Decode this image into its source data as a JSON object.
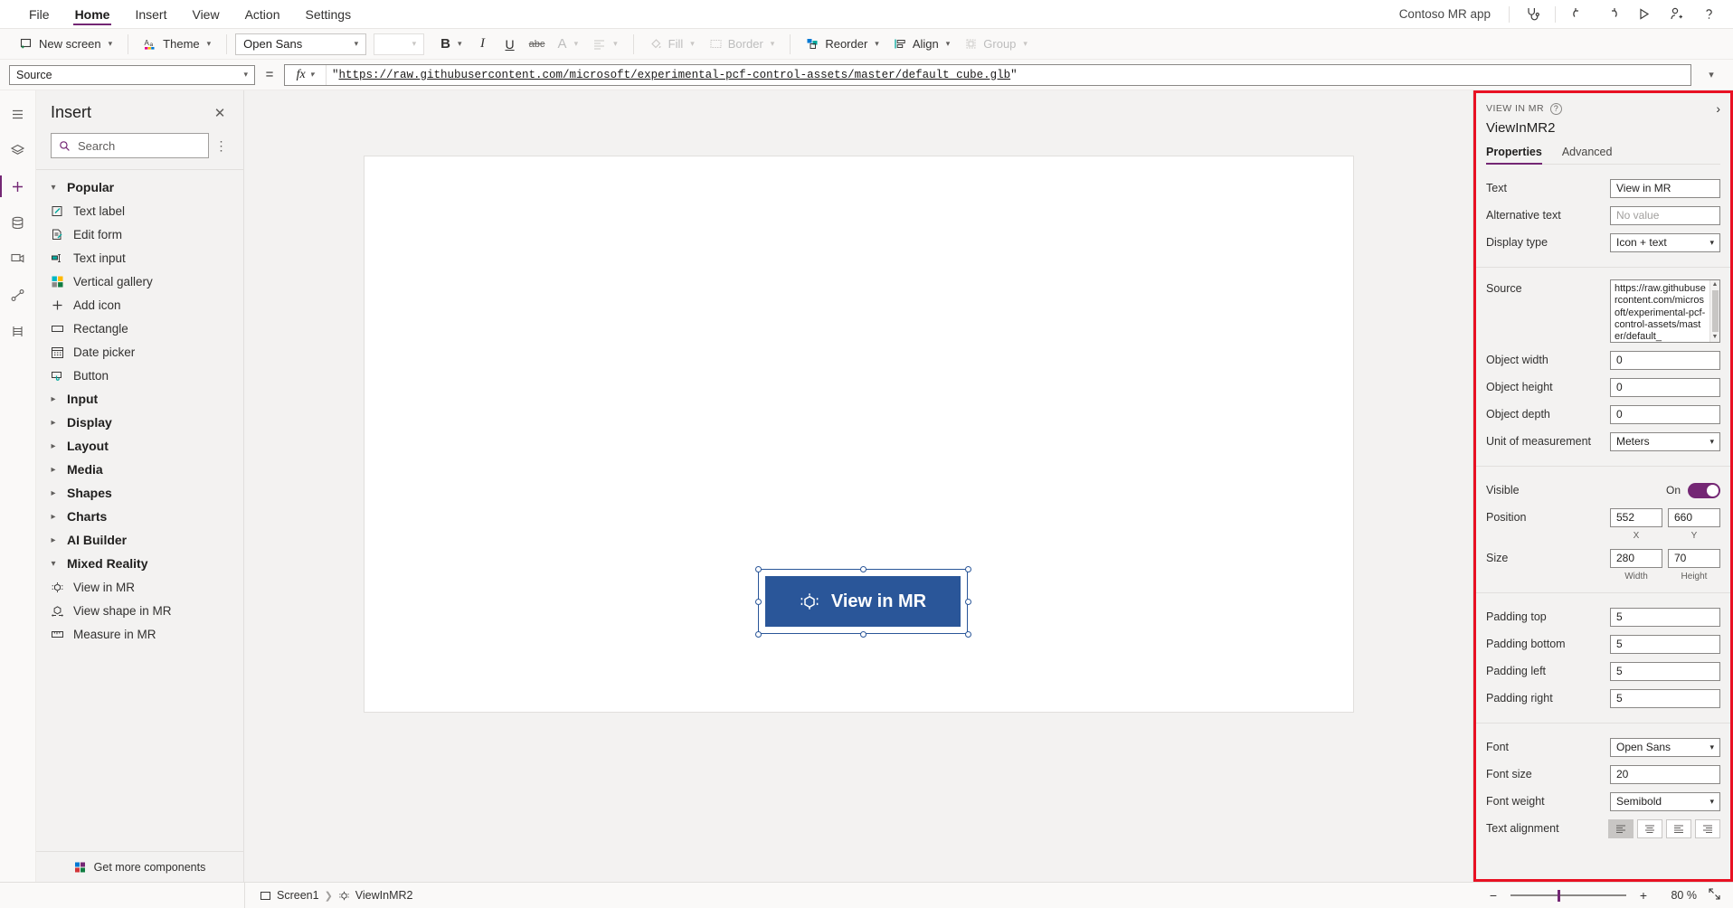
{
  "menubar": {
    "items": [
      "File",
      "Home",
      "Insert",
      "View",
      "Action",
      "Settings"
    ],
    "active": "Home",
    "app_name": "Contoso MR app",
    "icons": [
      "stethoscope-icon",
      "undo-icon",
      "redo-icon",
      "play-icon",
      "share-user-icon",
      "help-icon"
    ]
  },
  "ribbon": {
    "new_screen": "New screen",
    "theme": "Theme",
    "font_family": "Open Sans",
    "font_size": "",
    "bold": "B",
    "italic": "I",
    "underline": "U",
    "strikethrough": "abc",
    "font_color": "A",
    "align": "align-icon",
    "fill": "Fill",
    "border": "Border",
    "reorder": "Reorder",
    "align_label": "Align",
    "group": "Group"
  },
  "formula_bar": {
    "property": "Source",
    "equals": "=",
    "fx": "fx",
    "value_quote_open": "\"",
    "value_url": "https://raw.githubusercontent.com/microsoft/experimental-pcf-control-assets/master/default_cube.glb",
    "value_quote_close": "\""
  },
  "rail": {
    "items": [
      "hamburger-menu-icon",
      "layers-icon",
      "insert-plus-icon",
      "data-icon",
      "media-icon",
      "flow-icon",
      "variables-icon"
    ]
  },
  "insert_panel": {
    "title": "Insert",
    "close": "✕",
    "search_placeholder": "Search",
    "more": "⋮",
    "groups": [
      {
        "label": "Popular",
        "expanded": true,
        "items": [
          {
            "label": "Text label",
            "icon": "text-label-icon"
          },
          {
            "label": "Edit form",
            "icon": "edit-form-icon"
          },
          {
            "label": "Text input",
            "icon": "text-input-icon"
          },
          {
            "label": "Vertical gallery",
            "icon": "vertical-gallery-icon"
          },
          {
            "label": "Add icon",
            "icon": "add-icon"
          },
          {
            "label": "Rectangle",
            "icon": "rectangle-icon"
          },
          {
            "label": "Date picker",
            "icon": "date-picker-icon"
          },
          {
            "label": "Button",
            "icon": "button-icon"
          }
        ]
      },
      {
        "label": "Input",
        "expanded": false,
        "items": []
      },
      {
        "label": "Display",
        "expanded": false,
        "items": []
      },
      {
        "label": "Layout",
        "expanded": false,
        "items": []
      },
      {
        "label": "Media",
        "expanded": false,
        "items": []
      },
      {
        "label": "Shapes",
        "expanded": false,
        "items": []
      },
      {
        "label": "Charts",
        "expanded": false,
        "items": []
      },
      {
        "label": "AI Builder",
        "expanded": false,
        "items": []
      },
      {
        "label": "Mixed Reality",
        "expanded": true,
        "items": [
          {
            "label": "View in MR",
            "icon": "view-in-mr-icon"
          },
          {
            "label": "View shape in MR",
            "icon": "view-shape-in-mr-icon"
          },
          {
            "label": "Measure in MR",
            "icon": "measure-in-mr-icon"
          }
        ]
      }
    ],
    "footer": "Get more components"
  },
  "canvas": {
    "button_label": "View in MR",
    "button_icon": "view-in-mr-icon",
    "button_color": "#2a5699"
  },
  "properties": {
    "kicker": "VIEW IN MR",
    "help": "?",
    "collapse": "›",
    "control_name": "ViewInMR2",
    "tabs": [
      "Properties",
      "Advanced"
    ],
    "active_tab": "Properties",
    "accent": "#742774",
    "highlight_border": "#e81123",
    "sections": [
      {
        "fields": [
          {
            "label": "Text",
            "type": "text",
            "value": "View in MR"
          },
          {
            "label": "Alternative text",
            "type": "text",
            "value": "No value",
            "placeholder": true
          },
          {
            "label": "Display type",
            "type": "select",
            "value": "Icon + text"
          }
        ]
      },
      {
        "fields": [
          {
            "label": "Source",
            "type": "textarea",
            "value": "https://raw.githubusercontent.com/microsoft/experimental-pcf-control-assets/master/default_"
          },
          {
            "label": "Object width",
            "type": "number",
            "value": "0"
          },
          {
            "label": "Object height",
            "type": "number",
            "value": "0"
          },
          {
            "label": "Object depth",
            "type": "number",
            "value": "0"
          },
          {
            "label": "Unit of measurement",
            "type": "select",
            "value": "Meters"
          }
        ]
      },
      {
        "fields": [
          {
            "label": "Visible",
            "type": "toggle",
            "value": "On"
          },
          {
            "label": "Position",
            "type": "pair",
            "value_x": "552",
            "value_y": "660",
            "sub_x": "X",
            "sub_y": "Y"
          },
          {
            "label": "Size",
            "type": "pair",
            "value_x": "280",
            "value_y": "70",
            "sub_x": "Width",
            "sub_y": "Height"
          }
        ]
      },
      {
        "fields": [
          {
            "label": "Padding top",
            "type": "number",
            "value": "5"
          },
          {
            "label": "Padding bottom",
            "type": "number",
            "value": "5"
          },
          {
            "label": "Padding left",
            "type": "number",
            "value": "5"
          },
          {
            "label": "Padding right",
            "type": "number",
            "value": "5"
          }
        ]
      },
      {
        "fields": [
          {
            "label": "Font",
            "type": "select",
            "value": "Open Sans"
          },
          {
            "label": "Font size",
            "type": "number",
            "value": "20"
          },
          {
            "label": "Font weight",
            "type": "select",
            "value": "Semibold"
          },
          {
            "label": "Text alignment",
            "type": "align",
            "selected": 0
          }
        ]
      }
    ]
  },
  "status_bar": {
    "screen": "Screen1",
    "control": "ViewInMR2",
    "zoom_out": "−",
    "zoom_in": "+",
    "zoom_value": "80",
    "zoom_unit": "%",
    "fit": "fit-screen-icon"
  }
}
